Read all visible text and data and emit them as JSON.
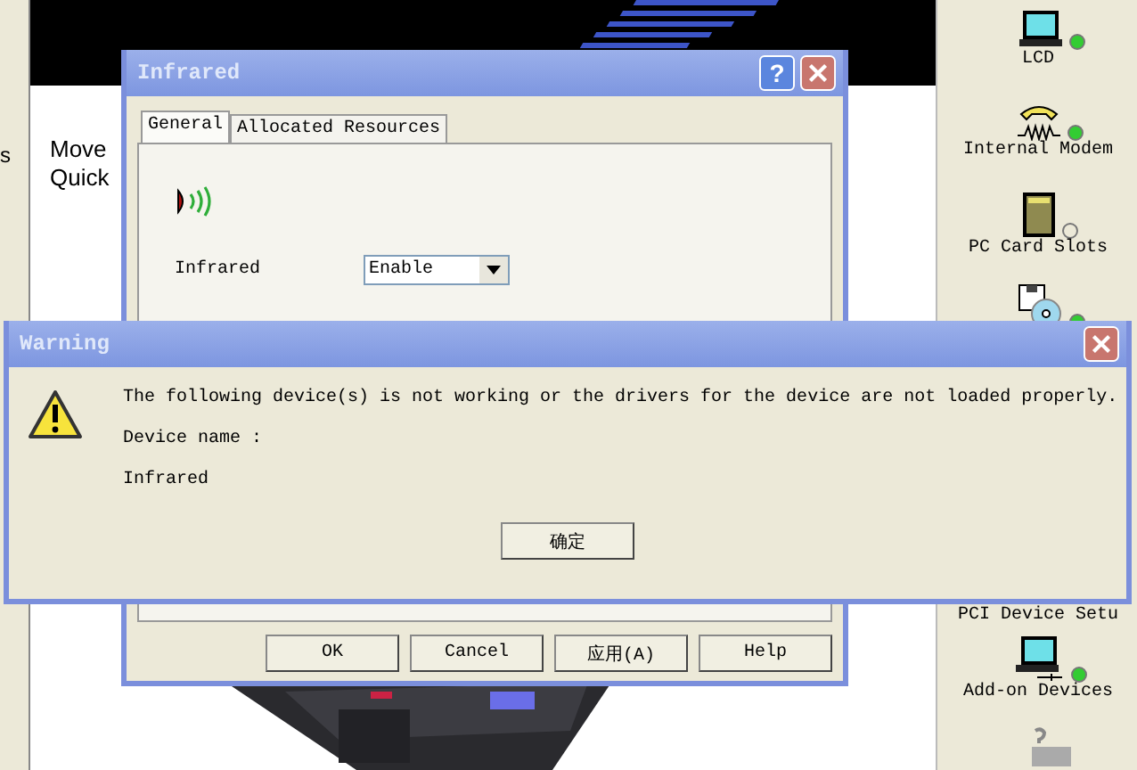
{
  "background": {
    "left_text": "s",
    "desktop_text": [
      "Move",
      "Quick"
    ]
  },
  "device_panel": {
    "items": [
      {
        "kind": "laptop",
        "label": "LCD",
        "on": true
      },
      {
        "kind": "modem",
        "label": "Internal Modem",
        "on": true
      },
      {
        "kind": "card",
        "label": "PC Card Slots",
        "on": false
      },
      {
        "kind": "disc",
        "on": true
      },
      {
        "kind": "hidden",
        "label": "PCI Device Setu"
      },
      {
        "kind": "usb",
        "label": "Add-on Devices",
        "on": true
      },
      {
        "kind": "unknown"
      }
    ]
  },
  "infrared_dialog": {
    "title": "Infrared",
    "help": "?",
    "tabs": [
      {
        "label": "General",
        "selected": true
      },
      {
        "label": "Allocated Resources",
        "selected": false
      }
    ],
    "field": {
      "label": "Infrared",
      "value": "Enable"
    },
    "buttons": [
      "OK",
      "Cancel",
      "应用(A)",
      "Help"
    ]
  },
  "warning_dialog": {
    "title": "Warning",
    "message": [
      "The following device(s) is not working or the drivers for the device are not loaded properly.",
      "Device name :",
      "Infrared"
    ],
    "button": "确定"
  }
}
